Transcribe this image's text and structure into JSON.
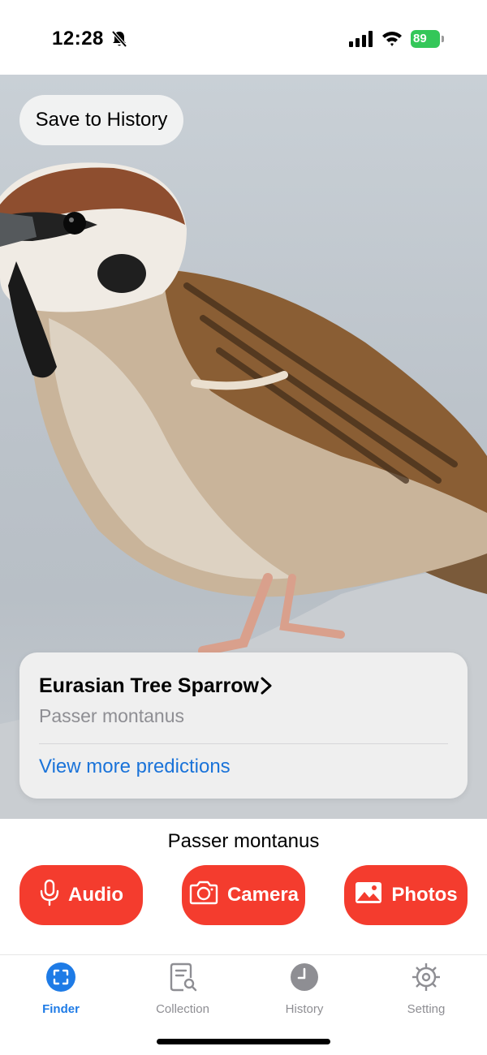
{
  "status_bar": {
    "time": "12:28",
    "battery": "89",
    "battery_color": "#34c759"
  },
  "photo": {
    "save_label": "Save to History"
  },
  "prediction": {
    "common_name": "Eurasian Tree Sparrow",
    "scientific_name": "Passer montanus",
    "more_link": "View more predictions"
  },
  "result_label": "Passer montanus",
  "actions": [
    {
      "label": "Audio",
      "icon": "microphone-icon"
    },
    {
      "label": "Camera",
      "icon": "camera-icon"
    },
    {
      "label": "Photos",
      "icon": "photo-icon"
    }
  ],
  "tabs": [
    {
      "label": "Finder",
      "icon": "scan-icon",
      "active": true
    },
    {
      "label": "Collection",
      "icon": "collection-search-icon",
      "active": false
    },
    {
      "label": "History",
      "icon": "clock-icon",
      "active": false
    },
    {
      "label": "Setting",
      "icon": "gear-icon",
      "active": false
    }
  ],
  "colors": {
    "accent_red": "#f43c2e",
    "link_blue": "#1a73d9",
    "tab_active": "#1e7be6",
    "tab_inactive": "#8e8e93"
  }
}
